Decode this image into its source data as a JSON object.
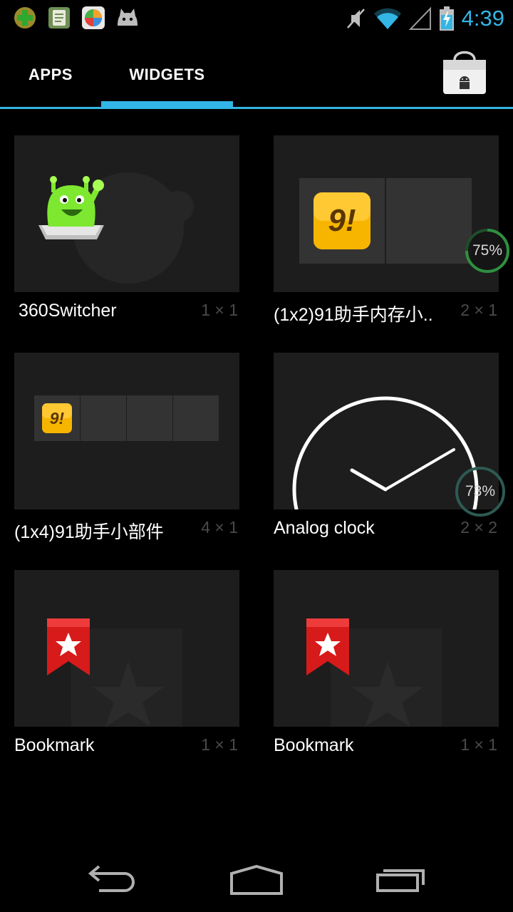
{
  "status_bar": {
    "time": "4:39",
    "notification_icons": [
      "plus-app-icon",
      "notepad-icon",
      "browser-app-icon",
      "android-cat-icon"
    ],
    "system_icons": [
      "mute-icon",
      "wifi-icon",
      "signal-icon",
      "battery-charging-icon"
    ]
  },
  "tabs": [
    {
      "label": "APPS",
      "selected": false
    },
    {
      "label": "WIDGETS",
      "selected": true
    }
  ],
  "accent_color": "#33b5e5",
  "widgets": [
    {
      "label": "360Switcher",
      "size": "1 × 1",
      "icon": "360switcher-icon"
    },
    {
      "label": "(1x2)91助手内存小..",
      "size": "2 × 1",
      "icon": "91-assistant-icon"
    },
    {
      "label": "(1x4)91助手小部件",
      "size": "4 × 1",
      "icon": "91-assistant-icon"
    },
    {
      "label": "Analog clock",
      "size": "2 × 2",
      "icon": "analog-clock-icon"
    },
    {
      "label": "Bookmark",
      "size": "1 × 1",
      "icon": "bookmark-icon"
    },
    {
      "label": "Bookmark",
      "size": "1 × 1",
      "icon": "bookmark-icon"
    }
  ],
  "overlays": [
    {
      "text": "75%"
    },
    {
      "text": "73%"
    }
  ],
  "nav_bar": [
    "back-icon",
    "home-icon",
    "recent-apps-icon"
  ]
}
